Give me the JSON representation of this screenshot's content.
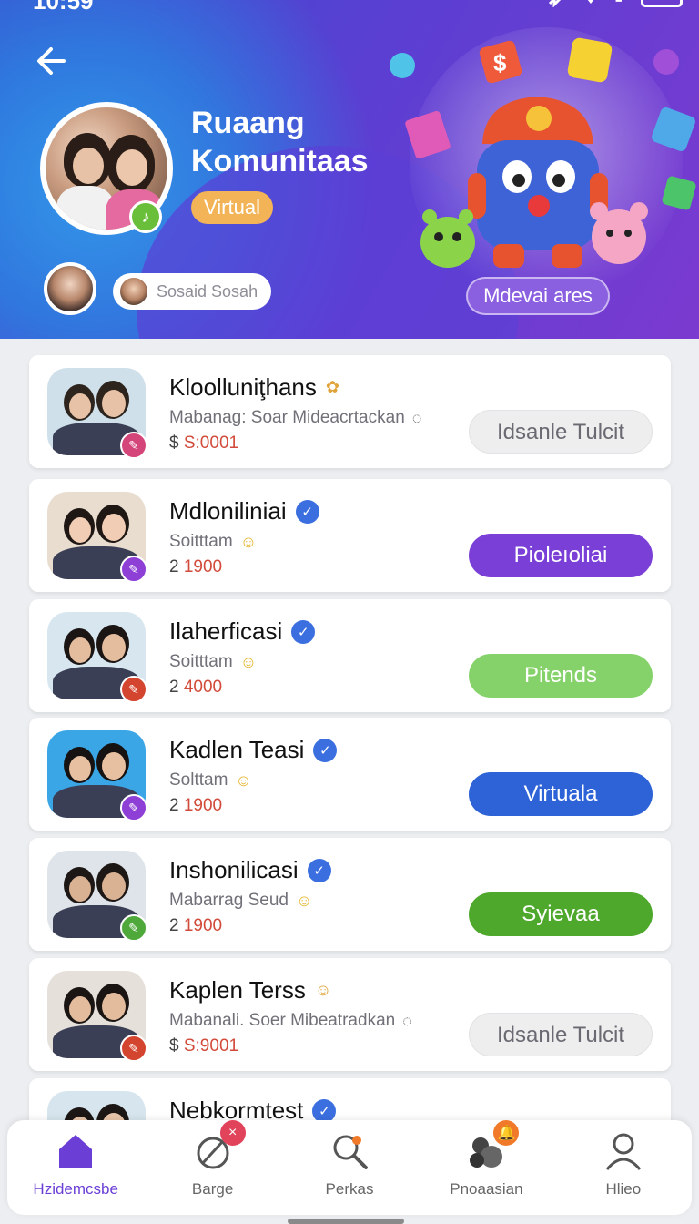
{
  "status_bar": {
    "time": "10:59"
  },
  "header": {
    "title": "Ruaang Komunitaas",
    "tag": "Virtual",
    "user_name": "Sosaid Sosah",
    "cta": "Mdevai ares"
  },
  "cards": [
    {
      "name": "Kloolluniţhans",
      "subtitle": "Mabanag: Soar Mideacrtackan",
      "currency": "$",
      "price": "S:0001",
      "action": "Idsanle Tulcit",
      "action_style": "ghost",
      "badge_color": "#d4457a",
      "verified": false,
      "emoji": "✿",
      "sub_emoji": ""
    },
    {
      "name": "Mdloniliniai",
      "subtitle": "Soitttam",
      "currency": "2",
      "price": "1900",
      "action": "Pioleıoliai",
      "action_style": "purple",
      "badge_color": "#8e3fd6",
      "verified": true,
      "emoji": "",
      "sub_emoji": "☺"
    },
    {
      "name": "Ilaherficasi",
      "subtitle": "Soitttam",
      "currency": "2",
      "price": "4000",
      "action": "Pitends",
      "action_style": "lightgreen",
      "badge_color": "#d4452f",
      "verified": true,
      "emoji": "",
      "sub_emoji": "☺"
    },
    {
      "name": "Kadlen Teasi",
      "subtitle": "Solttam",
      "currency": "2",
      "price": "1900",
      "action": "Virtuala",
      "action_style": "blue",
      "badge_color": "#8e3fd6",
      "verified": true,
      "emoji": "",
      "sub_emoji": "☺"
    },
    {
      "name": "Inshonilicasi",
      "subtitle": "Mabarrag Seud",
      "currency": "2",
      "price": "1900",
      "action": "Syievaa",
      "action_style": "green",
      "badge_color": "#4fa83a",
      "verified": true,
      "emoji": "",
      "sub_emoji": "☺"
    },
    {
      "name": "Kaplen Terss",
      "subtitle": "Mabanali. Soer Mibeatradkan",
      "currency": "$",
      "price": "S:9001",
      "action": "Idsanle Tulcit",
      "action_style": "ghost",
      "badge_color": "#d4452f",
      "verified": false,
      "emoji": "☺",
      "sub_emoji": ""
    },
    {
      "name": "Nebkormtest",
      "subtitle": "",
      "currency": "",
      "price": "",
      "action": "",
      "action_style": "none",
      "badge_color": "#8e3fd6",
      "verified": true,
      "emoji": "",
      "sub_emoji": ""
    }
  ],
  "nav": [
    {
      "label": "Hzidemcsbe",
      "icon": "home-icon",
      "active": true
    },
    {
      "label": "Barge",
      "icon": "badge-icon",
      "active": false,
      "badge": "×",
      "badge_color": "#e0435a"
    },
    {
      "label": "Perkas",
      "icon": "search-icon",
      "active": false
    },
    {
      "label": "Pnoaasian",
      "icon": "group-icon",
      "active": false,
      "badge": "🔔",
      "badge_color": "#f07a2a"
    },
    {
      "label": "Hlieo",
      "icon": "profile-icon",
      "active": false
    }
  ],
  "colors": {
    "purple": "#7a3fd6",
    "lightgreen": "#86d26a",
    "blue": "#2d63d6",
    "green": "#4ea82c",
    "active_nav": "#6b3fd6"
  }
}
